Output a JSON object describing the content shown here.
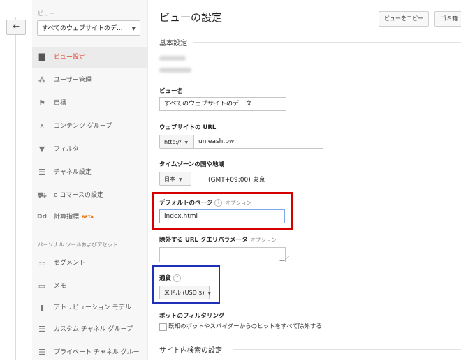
{
  "nav": {
    "back_icon": "arrow-left-icon"
  },
  "sidebar": {
    "view_caption": "ビュー",
    "view_select": "すべてのウェブサイトのデ...",
    "items": [
      {
        "label": "ビュー設定",
        "icon": "document-icon",
        "glyph": "▇"
      },
      {
        "label": "ユーザー管理",
        "icon": "users-icon",
        "glyph": "⁂"
      },
      {
        "label": "目標",
        "icon": "flag-icon",
        "glyph": "⚑"
      },
      {
        "label": "コンテンツ グループ",
        "icon": "person-icon",
        "glyph": "⋏"
      },
      {
        "label": "フィルタ",
        "icon": "filter-icon",
        "glyph": "▼"
      },
      {
        "label": "チャネル設定",
        "icon": "sliders-icon",
        "glyph": "☰"
      },
      {
        "label": "e コマースの設定",
        "icon": "cart-icon",
        "glyph": "⛟"
      },
      {
        "label": "計算指標",
        "icon": "dd-icon",
        "glyph": "Dd",
        "badge": "BETA"
      }
    ],
    "section_heading": "パーソナル ツールおよびアセット",
    "personal_items": [
      {
        "label": "セグメント",
        "icon": "segment-icon",
        "glyph": "☷"
      },
      {
        "label": "メモ",
        "icon": "note-icon",
        "glyph": "▭"
      },
      {
        "label": "アトリビューション モデル",
        "icon": "bar-chart-icon",
        "glyph": "▮"
      },
      {
        "label": "カスタム チャネル グループ",
        "icon": "sliders-icon",
        "glyph": "☰"
      },
      {
        "label": "プライベート チャネル グルー",
        "icon": "sliders-icon",
        "glyph": "☰"
      }
    ]
  },
  "header": {
    "title": "ビューの設定",
    "copy_button": "ビューをコピー",
    "trash_button": "ゴミ箱"
  },
  "form": {
    "basic_heading": "基本設定",
    "view_name_label": "ビュー名",
    "view_name_value": "すべてのウェブサイトのデータ",
    "website_url_label": "ウェブサイトの URL",
    "protocol": "http://",
    "url_value": "unleash.pw",
    "timezone_label": "タイムゾーンの国や地域",
    "country": "日本",
    "timezone_value": "(GMT+09:00) 東京",
    "default_page_label": "デフォルトのページ",
    "help_glyph": "?",
    "optional_text": "オプション",
    "default_page_value": "index.html",
    "exclude_params_label": "除外する URL クエリパラメータ",
    "currency_label": "通貨",
    "currency_value": "米ドル (USD $)",
    "bot_filter_label": "ボットのフィルタリング",
    "bot_filter_checkbox": "既知のボットやスパイダーからのヒットをすべて除外する",
    "site_search_heading": "サイト内検索の設定"
  },
  "colors": {
    "active_nav": "#dd4b39",
    "highlight_red": "#d40000",
    "highlight_blue": "#1f2fb8"
  }
}
